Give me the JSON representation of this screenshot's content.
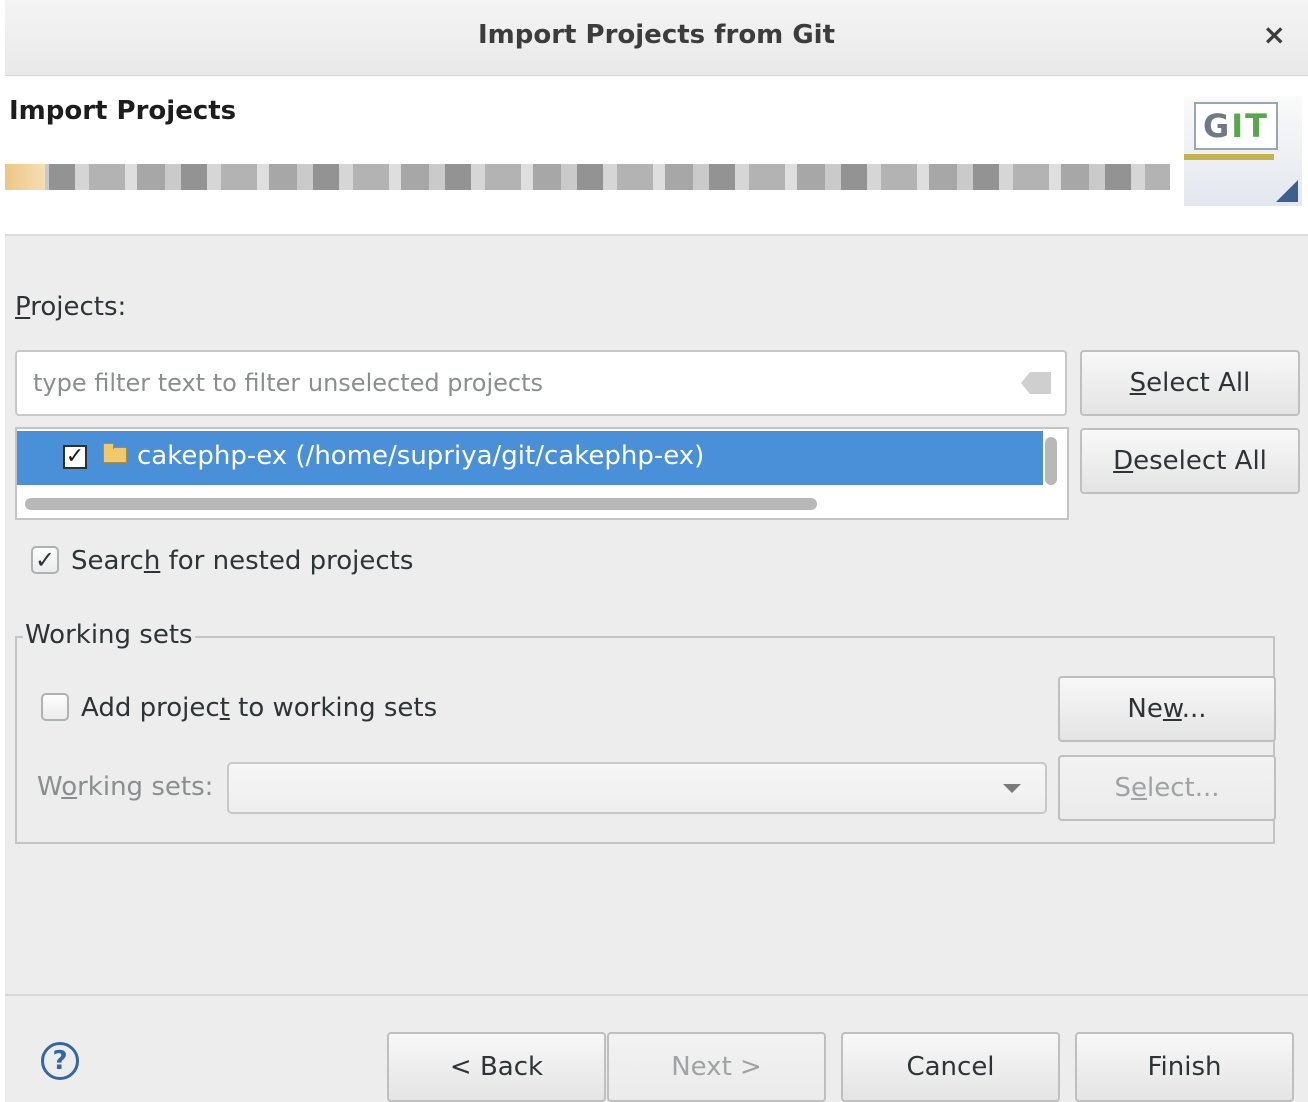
{
  "window": {
    "title": "Import Projects from Git",
    "close_glyph": "×"
  },
  "header": {
    "title": "Import Projects",
    "logo_text_g": "G",
    "logo_text_i": "I",
    "logo_text_t": "T"
  },
  "projects": {
    "label_u": "P",
    "label_rest": "rojects:",
    "filter_placeholder": "type filter text to filter unselected projects",
    "items": [
      {
        "label": "cakephp-ex (/home/supriya/git/cakephp-ex)",
        "checked": true,
        "selected": true
      }
    ],
    "select_all_u": "S",
    "select_all_rest": "elect All",
    "deselect_all_u": "D",
    "deselect_all_rest": "eselect All"
  },
  "nested": {
    "pre": "Searc",
    "u": "h",
    "post": " for nested projects",
    "checked": true
  },
  "working_sets": {
    "group_label": "Working sets",
    "add_pre": "Add projec",
    "add_u": "t",
    "add_post": " to working sets",
    "add_checked": false,
    "field_pre": "W",
    "field_u": "o",
    "field_post": "rking sets:",
    "field_value": "",
    "new_pre": "Ne",
    "new_u": "w",
    "new_post": "...",
    "select_pre": "S",
    "select_u": "e",
    "select_post": "lect..."
  },
  "footer": {
    "help_glyph": "?",
    "back": "< Back",
    "next": "Next >",
    "cancel": "Cancel",
    "finish": "Finish"
  },
  "colors": {
    "selection": "#4a90d9",
    "dialog_bg": "#ededed",
    "help_icon": "#3465a4"
  }
}
